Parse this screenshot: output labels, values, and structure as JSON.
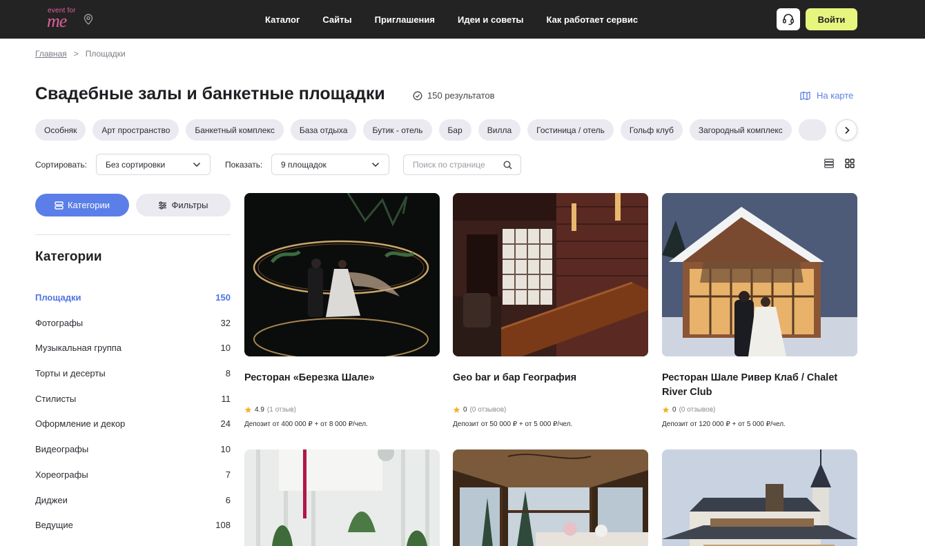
{
  "header": {
    "logo_small": "event for",
    "logo_big": "me",
    "nav": [
      "Каталог",
      "Сайты",
      "Приглашения",
      "Идеи и советы",
      "Как работает сервис"
    ],
    "login_label": "Войти",
    "login_color": "#e6f57d"
  },
  "breadcrumb": {
    "home": "Главная",
    "separator": ">",
    "current": "Площадки"
  },
  "title": "Свадебные залы и банкетные площадки",
  "results": "150 результатов",
  "map_link": "На карте",
  "chips": [
    "Особняк",
    "Арт пространство",
    "Банкетный комплекс",
    "База отдыха",
    "Бутик - отель",
    "Бар",
    "Вилла",
    "Гостиница / отель",
    "Гольф клуб",
    "Загородный комплекс"
  ],
  "controls": {
    "sort_label": "Сортировать:",
    "sort_value": "Без сортировки",
    "show_label": "Показать:",
    "show_value": "9 площадок",
    "search_placeholder": "Поиск по странице"
  },
  "sidebar": {
    "tab_categories": "Категории",
    "tab_filters": "Фильтры",
    "title": "Категории",
    "accent": "#5b7ee8",
    "items": [
      {
        "label": "Площадки",
        "count": "150",
        "active": true
      },
      {
        "label": "Фотографы",
        "count": "32"
      },
      {
        "label": "Музыкальная группа",
        "count": "10"
      },
      {
        "label": "Торты и десерты",
        "count": "8"
      },
      {
        "label": "Стилисты",
        "count": "11"
      },
      {
        "label": "Оформление и декор",
        "count": "24"
      },
      {
        "label": "Видеографы",
        "count": "10"
      },
      {
        "label": "Хореографы",
        "count": "7"
      },
      {
        "label": "Диджеи",
        "count": "6"
      },
      {
        "label": "Ведущие",
        "count": "108"
      }
    ]
  },
  "cards": [
    {
      "name": "Ресторан «Березка Шале»",
      "rating": "4.9",
      "reviews": "(1 отзыв)",
      "deposit": "Депозит от 400 000 ₽ + от 8 000 ₽/чел."
    },
    {
      "name": "Geo bar и бар География",
      "rating": "0",
      "reviews": "(0 отзывов)",
      "deposit": "Депозит от 50 000 ₽ + от 5 000 ₽/чел."
    },
    {
      "name": "Ресторан Шале Ривер Клаб / Chalet River Club",
      "rating": "0",
      "reviews": "(0 отзывов)",
      "deposit": "Депозит от 120 000 ₽ + от 5 000 ₽/чел."
    }
  ]
}
